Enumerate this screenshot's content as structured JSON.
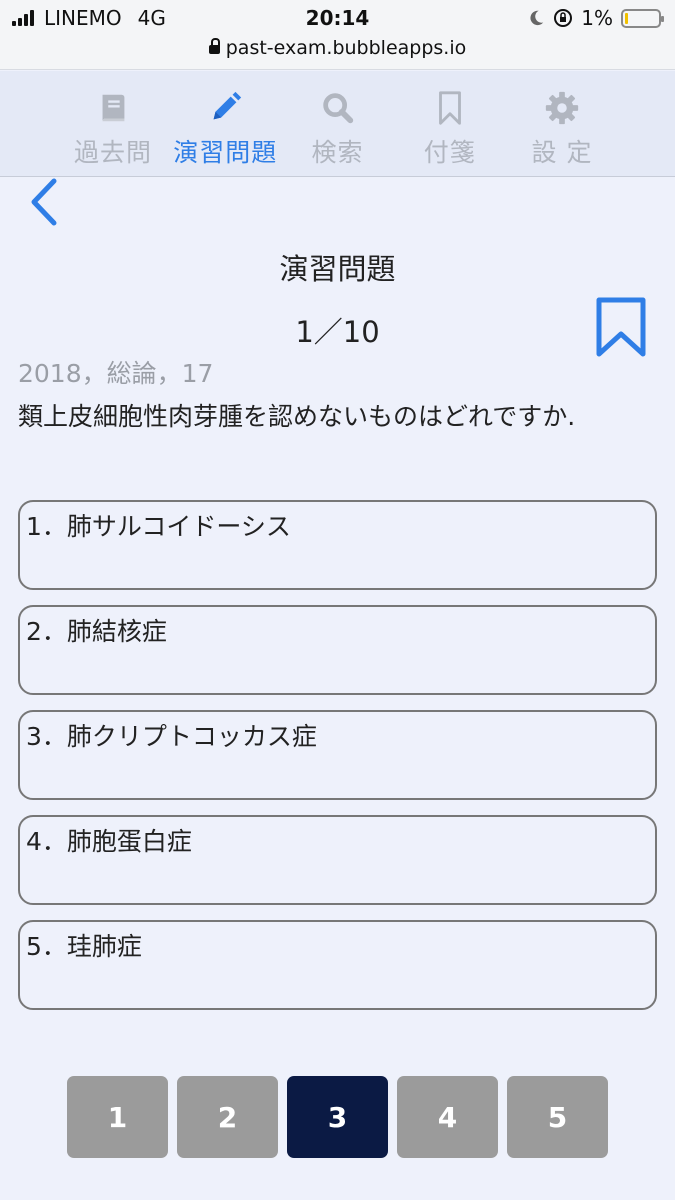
{
  "status_bar": {
    "carrier": "LINEMO",
    "network": "4G",
    "time": "20:14",
    "battery": "1%",
    "url": "past-exam.bubbleapps.io"
  },
  "nav": {
    "items": [
      {
        "label": "過去問",
        "icon": "book-icon",
        "active": false
      },
      {
        "label": "演習問題",
        "icon": "pencil-icon",
        "active": true
      },
      {
        "label": "検索",
        "icon": "search-icon",
        "active": false
      },
      {
        "label": "付箋",
        "icon": "bookmark-icon",
        "active": false
      },
      {
        "label": "設 定",
        "icon": "gear-icon",
        "active": false
      }
    ],
    "inactive_color": "#b1b6c0",
    "active_color": "#2f7ee6"
  },
  "page": {
    "title": "演習問題",
    "counter": "1／10",
    "meta": "2018，総論，17",
    "question": "類上皮細胞性肉芽腫を認めないものはどれですか."
  },
  "choices": [
    "1．肺サルコイドーシス",
    "2．肺結核症",
    "3．肺クリプトコッカス症",
    "4．肺胞蛋白症",
    "5．珪肺症"
  ],
  "pager": {
    "pages": [
      "1",
      "2",
      "3",
      "4",
      "5"
    ],
    "active": "3",
    "active_color": "#0b1a44",
    "inactive_color": "#9b9b9b"
  }
}
